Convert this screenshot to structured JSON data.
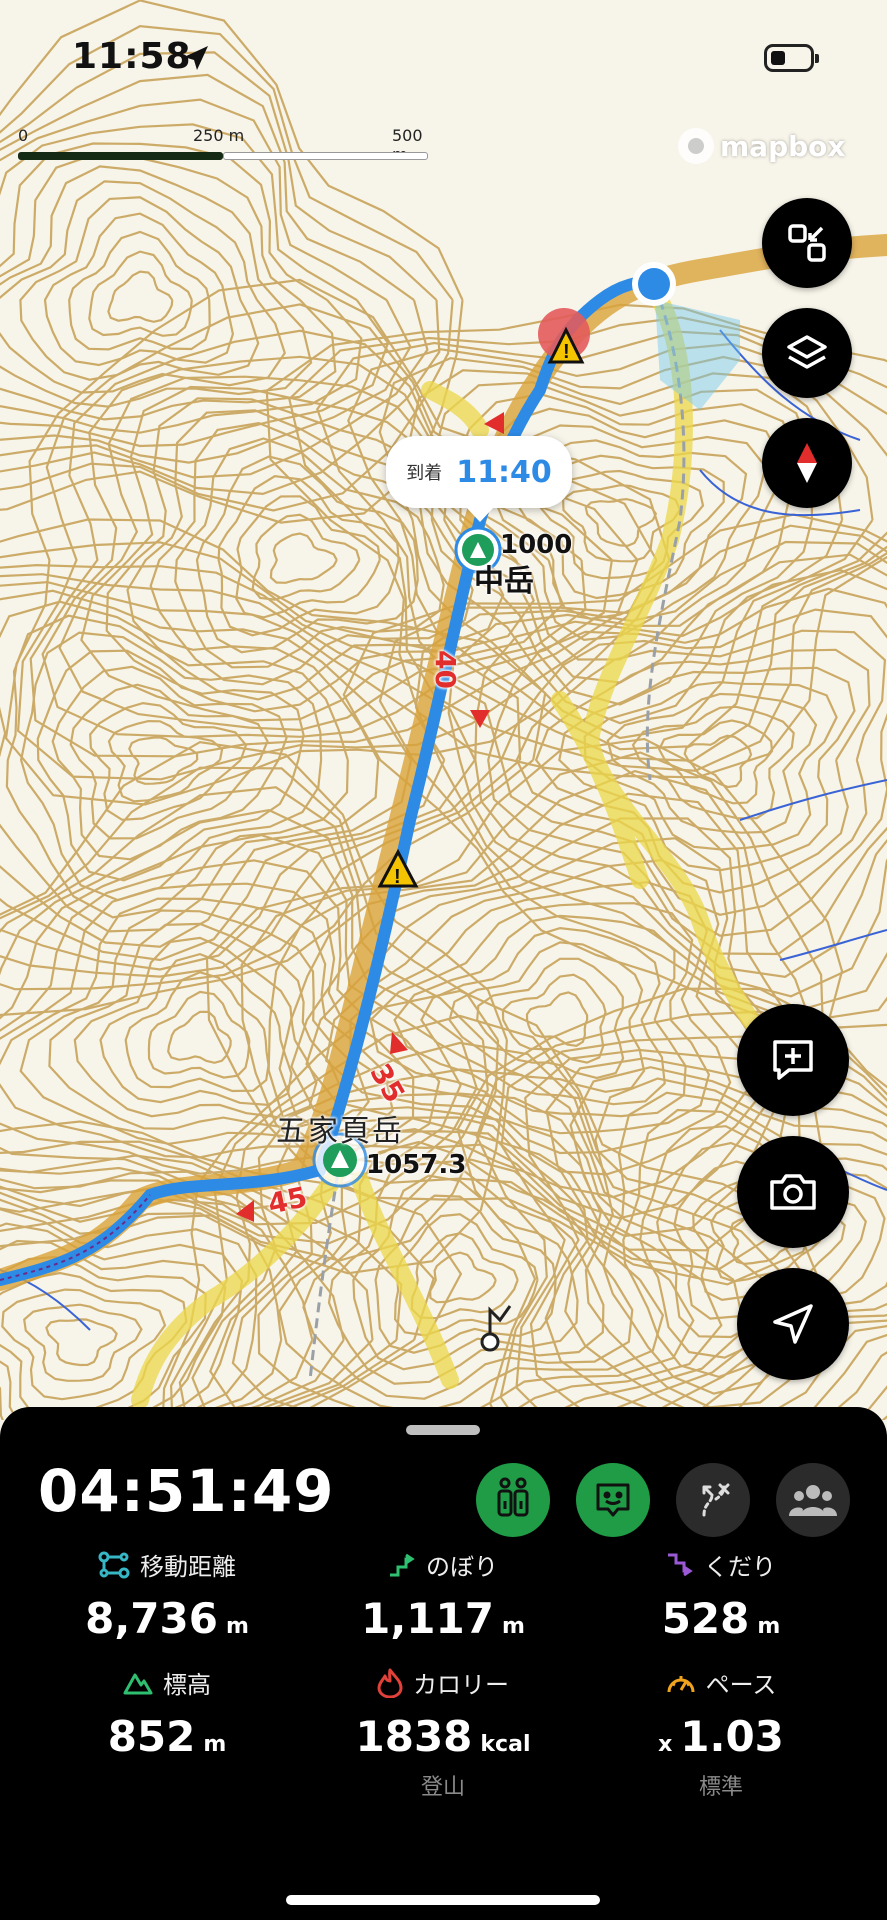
{
  "status_bar": {
    "time": "11:58"
  },
  "map": {
    "scale": {
      "labels": [
        "0",
        "250 m",
        "500 m"
      ]
    },
    "attribution": "mapbox",
    "arrival_bubble": {
      "label": "到着",
      "time": "11:40"
    },
    "summits": [
      {
        "name": "中岳",
        "elevation": "1000"
      },
      {
        "name": "五家頁岳",
        "elevation": "1057.3"
      }
    ],
    "route_time_labels": [
      "40",
      "35",
      "45"
    ],
    "colors": {
      "route": "#2d8be6",
      "contour": "#c8a45b",
      "trail": "#ecd84a",
      "stream": "#3a63d6",
      "warning": "#f5c400",
      "marker_red": "#e22d2d"
    },
    "buttons": [
      "collapse-icon",
      "layers-icon",
      "compass-icon",
      "add-note-icon",
      "camera-icon",
      "location-arrow-icon"
    ]
  },
  "panel": {
    "elapsed": "04:51:49",
    "modes": [
      {
        "name": "hiking-mode-icon",
        "active": true
      },
      {
        "name": "face-icon",
        "active": true
      },
      {
        "name": "route-icon",
        "active": false
      },
      {
        "name": "group-icon",
        "active": false
      }
    ],
    "stats": {
      "distance": {
        "label": "移動距離",
        "value": "8,736",
        "unit": "m"
      },
      "ascent": {
        "label": "のぼり",
        "value": "1,117",
        "unit": "m"
      },
      "descent": {
        "label": "くだり",
        "value": "528",
        "unit": "m"
      },
      "altitude": {
        "label": "標高",
        "value": "852",
        "unit": "m"
      },
      "calories": {
        "label": "カロリー",
        "value": "1838",
        "unit": "kcal",
        "sub": "登山"
      },
      "pace": {
        "label": "ペース",
        "prefix": "x",
        "value": "1.03",
        "sub": "標準"
      }
    }
  }
}
